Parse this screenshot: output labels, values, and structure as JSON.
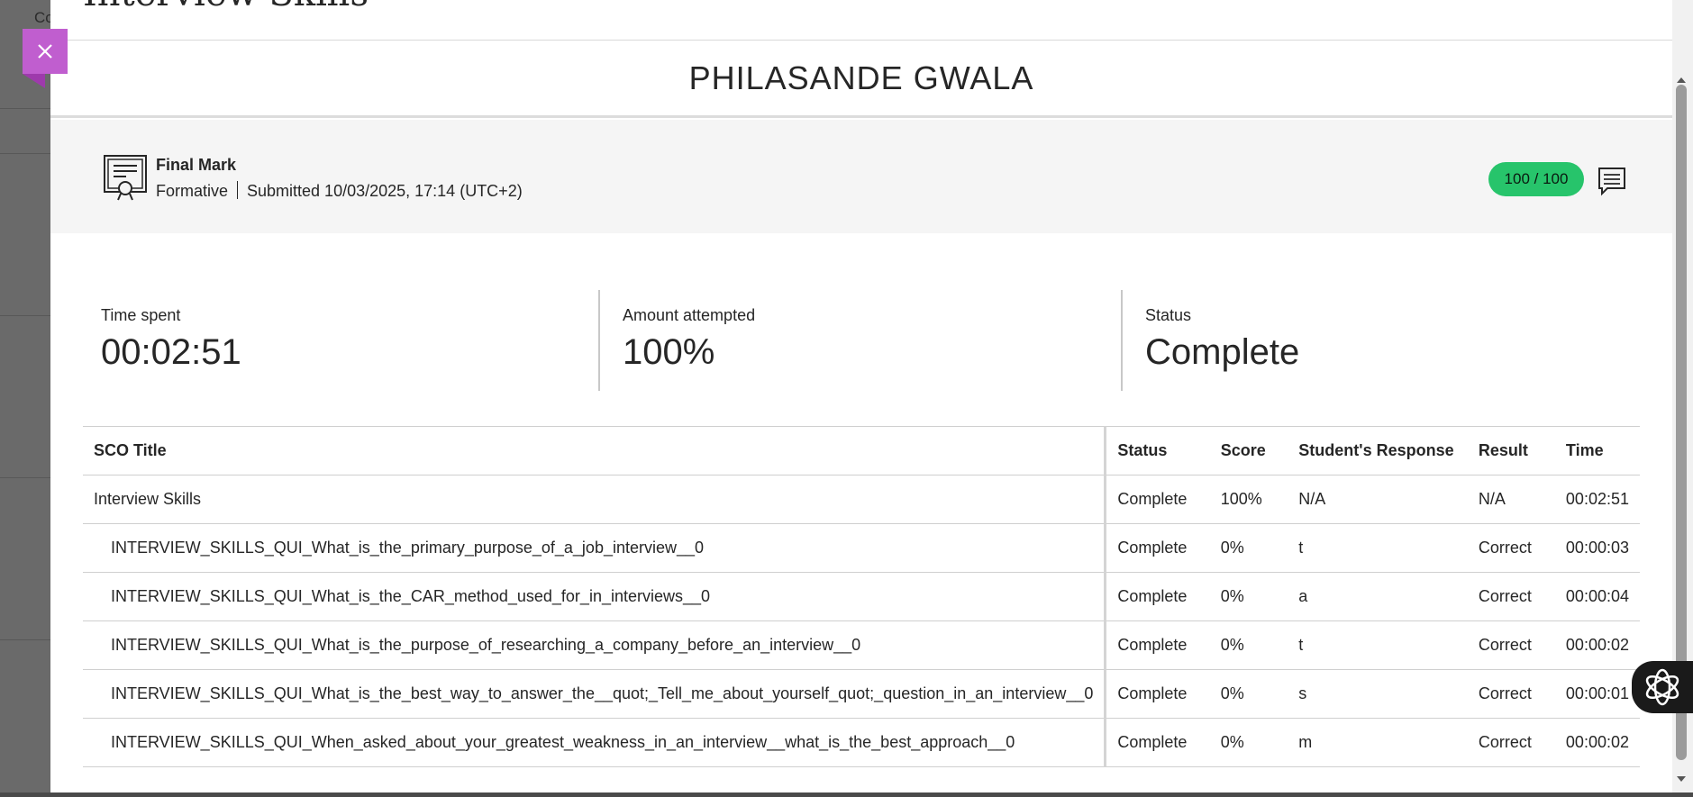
{
  "backdrop": {
    "text": "Co"
  },
  "modal": {
    "title": "Interview Skills",
    "student_name": "PHILASANDE GWALA",
    "close_icon": "close-icon"
  },
  "summary": {
    "icon": "certificate-icon",
    "label": "Final Mark",
    "type": "Formative",
    "submitted": "Submitted 10/03/2025, 17:14 (UTC+2)",
    "score": "100 / 100",
    "score_color": "#27c46b",
    "feedback_icon": "feedback-icon"
  },
  "stats": [
    {
      "label": "Time spent",
      "value": "00:02:51"
    },
    {
      "label": "Amount attempted",
      "value": "100%"
    },
    {
      "label": "Status",
      "value": "Complete"
    }
  ],
  "table": {
    "headers": [
      "SCO Title",
      "Status",
      "Score",
      "Student's Response",
      "Result",
      "Time"
    ],
    "rows": [
      [
        "Interview Skills",
        "Complete",
        "100%",
        "N/A",
        "N/A",
        "00:02:51"
      ],
      [
        "INTERVIEW_SKILLS_QUI_What_is_the_primary_purpose_of_a_job_interview__0",
        "Complete",
        "0%",
        "t",
        "Correct",
        "00:00:03"
      ],
      [
        "INTERVIEW_SKILLS_QUI_What_is_the_CAR_method_used_for_in_interviews__0",
        "Complete",
        "0%",
        "a",
        "Correct",
        "00:00:04"
      ],
      [
        "INTERVIEW_SKILLS_QUI_What_is_the_purpose_of_researching_a_company_before_an_interview__0",
        "Complete",
        "0%",
        "t",
        "Correct",
        "00:00:02"
      ],
      [
        "INTERVIEW_SKILLS_QUI_What_is_the_best_way_to_answer_the__quot;_Tell_me_about_yourself_quot;_question_in_an_interview__0",
        "Complete",
        "0%",
        "s",
        "Correct",
        "00:00:01"
      ],
      [
        "INTERVIEW_SKILLS_QUI_When_asked_about_your_greatest_weakness_in_an_interview__what_is_the_best_approach__0",
        "Complete",
        "0%",
        "m",
        "Correct",
        "00:00:02"
      ]
    ]
  },
  "assist": {
    "icon": "assistant-icon"
  }
}
